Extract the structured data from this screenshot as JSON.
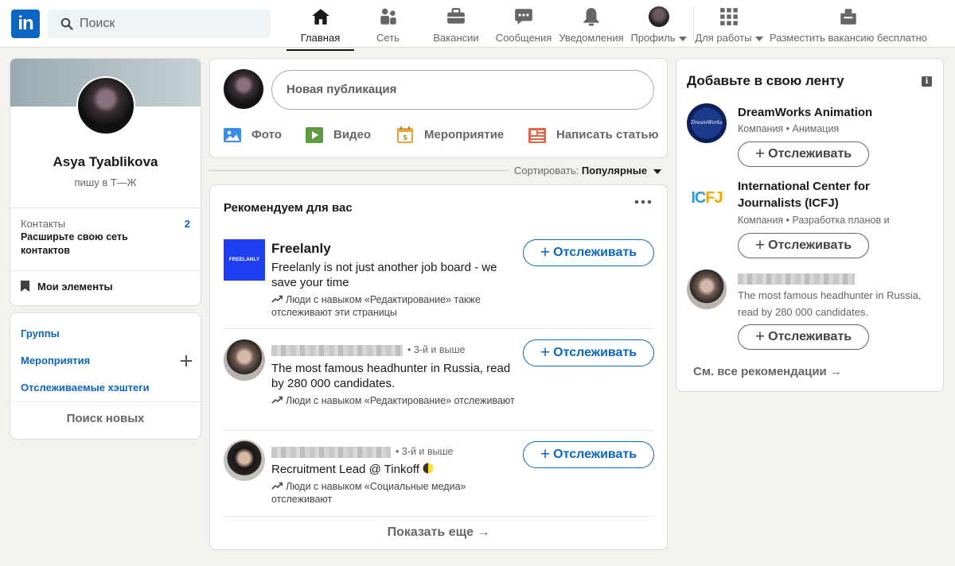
{
  "header": {
    "logo_text": "in",
    "search_placeholder": "Поиск",
    "nav": [
      {
        "label": "Главная",
        "icon": "home-icon"
      },
      {
        "label": "Сеть",
        "icon": "network-icon"
      },
      {
        "label": "Вакансии",
        "icon": "briefcase-icon"
      },
      {
        "label": "Сообщения",
        "icon": "messaging-icon"
      },
      {
        "label": "Уведомления",
        "icon": "bell-icon"
      },
      {
        "label": "Профиль",
        "icon": "avatar"
      },
      {
        "label": "Для работы",
        "icon": "grid-icon"
      },
      {
        "label": "Разместить вакансию бесплатно",
        "icon": "post-job-icon"
      }
    ]
  },
  "profile": {
    "name": "Asya Tyablikova",
    "headline": "пишу в Т—Ж",
    "contacts_label": "Контакты",
    "contacts_count": "2",
    "contacts_cta": "Расширьте свою сеть контактов",
    "my_items": "Мои элементы"
  },
  "left_links": {
    "groups": "Группы",
    "events": "Мероприятия",
    "hashtags": "Отслеживаемые хэштеги",
    "discover": "Поиск новых"
  },
  "composer": {
    "placeholder": "Новая публикация",
    "actions": [
      {
        "label": "Фото",
        "icon": "photo-icon",
        "color": "#378fe9"
      },
      {
        "label": "Видео",
        "icon": "video-icon",
        "color": "#5f9b41"
      },
      {
        "label": "Мероприятие",
        "icon": "calendar-icon",
        "color": "#c37d16"
      },
      {
        "label": "Написать статью",
        "icon": "article-icon",
        "color": "#e06847"
      }
    ]
  },
  "sort": {
    "label": "Сортировать:",
    "value": "Популярные"
  },
  "recommendations": {
    "title": "Рекомендуем для вас",
    "follow_label": "Отслеживать",
    "show_more": "Показать еще →",
    "items": [
      {
        "name": "Freelanly",
        "logo_text": "FREELANLY",
        "desc": "Freelanly is not just another job board - we save your time",
        "social": "Люди с навыком «Редактирование» также отслеживают эти страницы"
      },
      {
        "degree": "• 3-й и выше",
        "desc": "The most famous headhunter in Russia, read by 280 000 candidates.",
        "social": "Люди с навыком «Редактирование» отслеживают"
      },
      {
        "degree": "• 3-й и выше",
        "desc": "Recruitment Lead @ Tinkoff",
        "social": "Люди с навыком «Социальные медиа» отслеживают"
      }
    ]
  },
  "feed": {
    "title": "Добавьте в свою ленту",
    "follow_label": "Отслеживать",
    "see_all": "См. все рекомендации →",
    "items": [
      {
        "name": "DreamWorks Animation",
        "meta": "Компания • Анимация",
        "logo_text": "DreamWorks"
      },
      {
        "name": "International Center for Journalists (ICFJ)",
        "meta": "Компания • Разработка планов и",
        "logo_text": "ICFJ"
      },
      {
        "desc": "The most famous headhunter in Russia, read by 280 000 candidates."
      }
    ]
  },
  "colors": {
    "brand": "#0a66c2",
    "background": "#f3f2ef"
  }
}
